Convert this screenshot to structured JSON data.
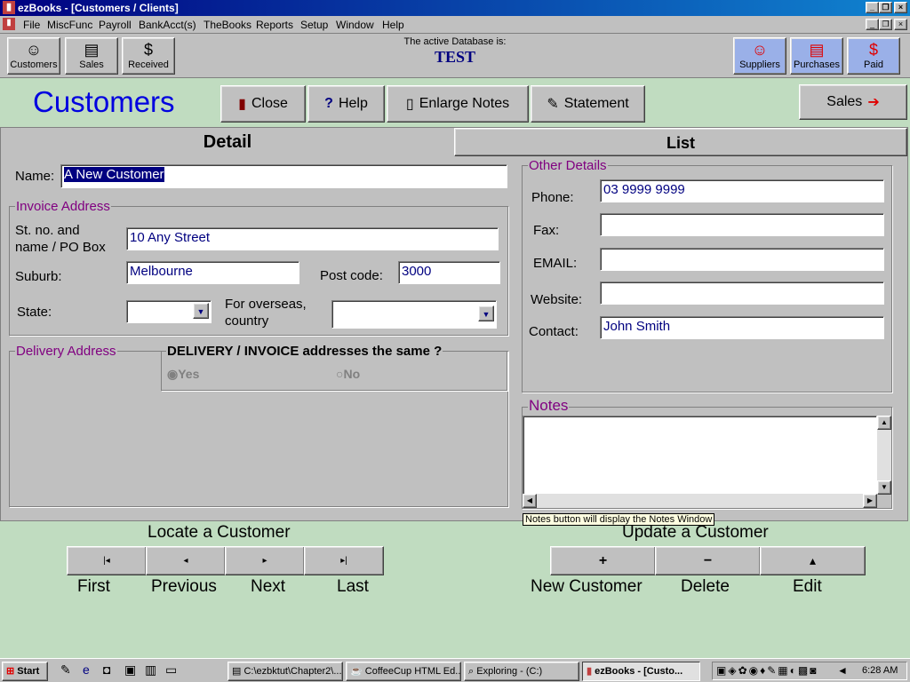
{
  "window": {
    "title": "ezBooks - [Customers / Clients]"
  },
  "menu": [
    "File",
    "MiscFunc",
    "Payroll",
    "BankAcct(s)",
    "TheBooks",
    "Reports",
    "Setup",
    "Window",
    "Help"
  ],
  "toolbar": {
    "left": [
      {
        "label": "Customers",
        "icon": "smiley-icon",
        "glyph": "☺"
      },
      {
        "label": "Sales",
        "icon": "documents-icon",
        "glyph": "▤"
      },
      {
        "label": "Received",
        "icon": "dollar-icon",
        "glyph": "$"
      }
    ],
    "right": [
      {
        "label": "Suppliers",
        "icon": "smiley-icon",
        "glyph": "☺"
      },
      {
        "label": "Purchases",
        "icon": "documents-icon",
        "glyph": "▤"
      },
      {
        "label": "Paid",
        "icon": "dollar-icon",
        "glyph": "$"
      }
    ],
    "db_caption": "The active Database is:",
    "db_name": "TEST"
  },
  "header": {
    "title": "Customers",
    "close": "Close",
    "help": "Help",
    "enlarge_notes": "Enlarge Notes",
    "statement": "Statement",
    "sales": "Sales"
  },
  "tabs": {
    "detail": "Detail",
    "list": "List"
  },
  "form": {
    "name_label": "Name:",
    "name_value": "A New Customer",
    "invoice_title": "Invoice Address",
    "street_label_1": "St. no. and",
    "street_label_2": "name / PO Box",
    "street_value": "10 Any Street",
    "suburb_label": "Suburb:",
    "suburb_value": "Melbourne",
    "postcode_label": "Post code:",
    "postcode_value": "3000",
    "state_label": "State:",
    "state_value": "",
    "overseas_label_1": "For overseas,",
    "overseas_label_2": "country",
    "country_value": "",
    "delivery_title": "Delivery Address",
    "same_question": "DELIVERY / INVOICE addresses the same ?",
    "yes": "Yes",
    "no": "No",
    "other_title": "Other Details",
    "phone_label": "Phone:",
    "phone_value": "03 9999 9999",
    "fax_label": "Fax:",
    "fax_value": "",
    "email_label": "EMAIL:",
    "email_value": "",
    "website_label": "Website:",
    "website_value": "",
    "contact_label": "Contact:",
    "contact_value": "John Smith",
    "notes_title": "Notes",
    "notes_value": ""
  },
  "tooltip": "Notes button will display the Notes Window",
  "locate": {
    "title": "Locate a Customer",
    "buttons": [
      {
        "glyph": "|◂",
        "label": "First"
      },
      {
        "glyph": "◂",
        "label": "Previous"
      },
      {
        "glyph": "▸",
        "label": "Next"
      },
      {
        "glyph": "▸|",
        "label": "Last"
      }
    ]
  },
  "update": {
    "title": "Update a Customer",
    "buttons": [
      {
        "glyph": "+",
        "label": "New Customer"
      },
      {
        "glyph": "−",
        "label": "Delete"
      },
      {
        "glyph": "▴",
        "label": "Edit"
      }
    ]
  },
  "taskbar": {
    "start": "Start",
    "tasks": [
      "C:\\ezbktut\\Chapter2\\...",
      "CoffeeCup HTML Ed...",
      "Exploring - (C:)",
      "ezBooks - [Custo..."
    ],
    "time": "6:28 AM"
  }
}
